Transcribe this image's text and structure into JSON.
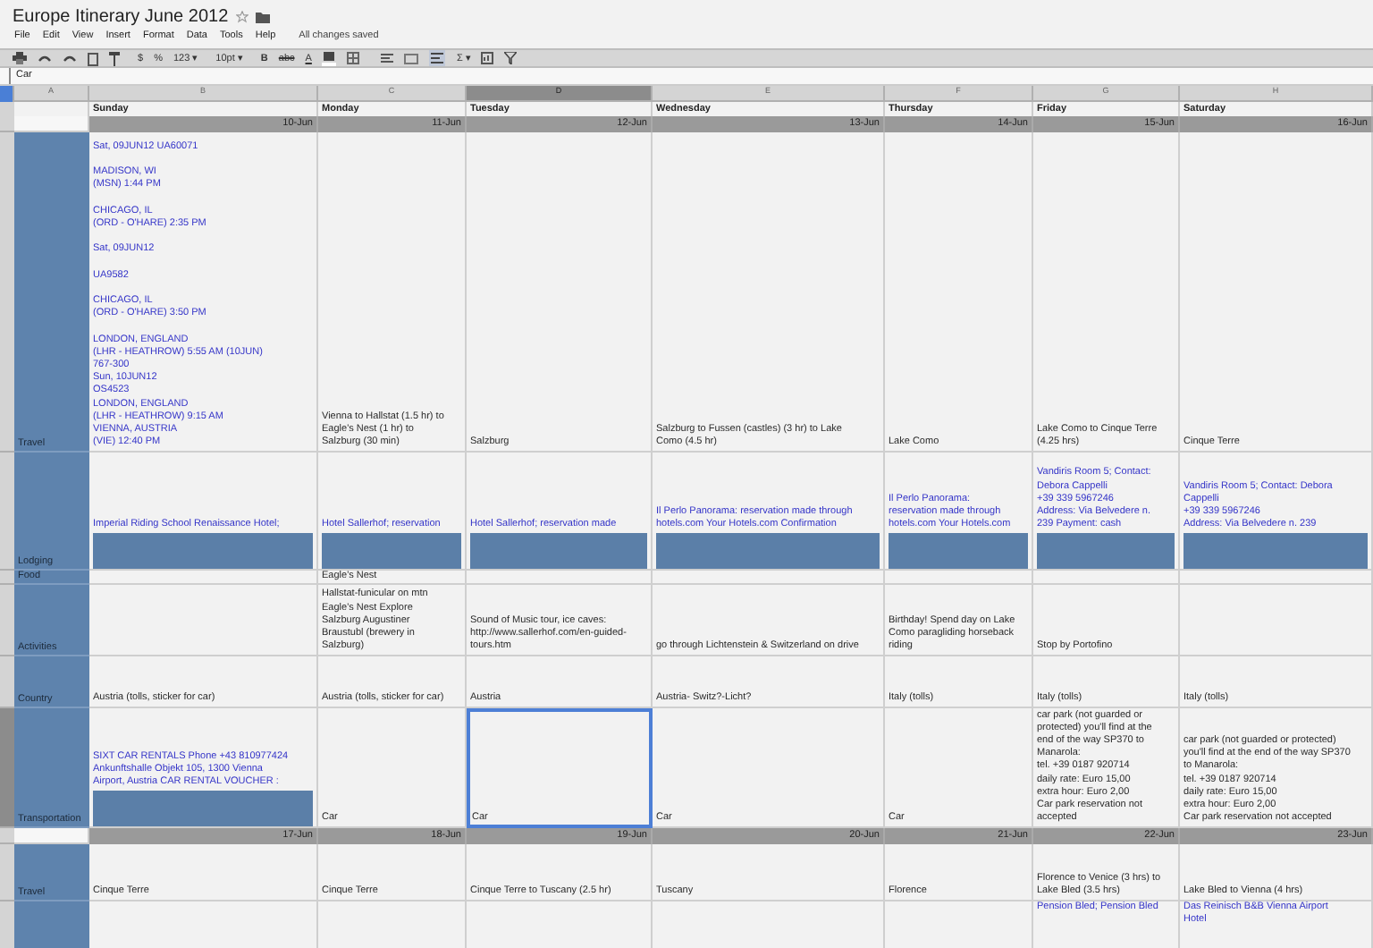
{
  "document": {
    "title": "Europe Itinerary June 2012",
    "save_status": "All changes saved"
  },
  "menu": [
    "File",
    "Edit",
    "View",
    "Insert",
    "Format",
    "Data",
    "Tools",
    "Help"
  ],
  "toolbar": {
    "currency": "$",
    "percent": "%",
    "number_format": "123 ▾",
    "font_size": "10pt ▾",
    "bold": "B",
    "strikethrough": "abc",
    "text_color": "A",
    "sum": "Σ ▾"
  },
  "formula_bar": {
    "value": "Car"
  },
  "columns": [
    {
      "letter": "A",
      "selected": false
    },
    {
      "letter": "B",
      "selected": false
    },
    {
      "letter": "C",
      "selected": false
    },
    {
      "letter": "D",
      "selected": true
    },
    {
      "letter": "E",
      "selected": false
    },
    {
      "letter": "F",
      "selected": false
    },
    {
      "letter": "G",
      "selected": false
    },
    {
      "letter": "H",
      "selected": false
    }
  ],
  "weeks": [
    {
      "day_names": [
        "Sunday",
        "Monday",
        "Tuesday",
        "Wednesday",
        "Thursday",
        "Friday",
        "Saturday"
      ],
      "dates": [
        "10-Jun",
        "11-Jun",
        "12-Jun",
        "13-Jun",
        "14-Jun",
        "15-Jun",
        "16-Jun"
      ],
      "rows": [
        {
          "label": "Travel",
          "cells": [
            {
              "kind": "link",
              "text": "Sat, 09JUN12 UA60071\n\nMADISON, WI\n(MSN) 1:44 PM\n\nCHICAGO, IL\n(ORD - O'HARE) 2:35 PM\n\nSat, 09JUN12\n\nUA9582\n\nCHICAGO, IL\n(ORD - O'HARE) 3:50 PM\n\nLONDON, ENGLAND\n(LHR - HEATHROW) 5:55 AM (10JUN)\n767-300\nSun, 10JUN12\nOS4523\nLONDON, ENGLAND\n(LHR - HEATHROW) 9:15 AM\nVIENNA, AUSTRIA\n(VIE) 12:40 PM",
              "selected": false
            },
            {
              "kind": "plain",
              "text": "Vienna to Hallstat (1.5 hr) to\nEagle's Nest (1 hr) to\nSalzburg (30 min)",
              "selected": false
            },
            {
              "kind": "plain",
              "text": "Salzburg",
              "selected": false
            },
            {
              "kind": "plain",
              "text": "Salzburg to Fussen (castles) (3 hr) to Lake\nComo (4.5 hr)",
              "selected": false
            },
            {
              "kind": "plain",
              "text": "Lake Como",
              "selected": false
            },
            {
              "kind": "plain",
              "text": "Lake Como to Cinque Terre\n(4.25 hrs)",
              "selected": false
            },
            {
              "kind": "plain",
              "text": "Cinque Terre",
              "selected": false
            }
          ]
        },
        {
          "label": "Lodging",
          "cells": [
            {
              "kind": "link",
              "text": "Imperial Riding School Renaissance Hotel;",
              "redacted": true,
              "selected": false
            },
            {
              "kind": "link",
              "text": "Hotel Sallerhof; reservation",
              "redacted": true,
              "selected": false
            },
            {
              "kind": "link",
              "text": "Hotel Sallerhof; reservation made",
              "redacted": true,
              "selected": false
            },
            {
              "kind": "link",
              "text": "Il Perlo Panorama: reservation made through\nhotels.com Your Hotels.com Confirmation",
              "redacted": true,
              "selected": false
            },
            {
              "kind": "link",
              "text": "Il Perlo Panorama:\nreservation made through\nhotels.com Your Hotels.com",
              "redacted": true,
              "selected": false
            },
            {
              "kind": "link",
              "text": "Vandiris Room 5; Contact:\nDebora Cappelli\n+39 339 5967246\nAddress: Via Belvedere n.\n239 Payment: cash",
              "redacted": true,
              "selected": false
            },
            {
              "kind": "link",
              "text": "Vandiris Room 5; Contact: Debora\nCappelli\n+39 339 5967246\nAddress: Via Belvedere n. 239",
              "redacted": true,
              "selected": false
            }
          ]
        },
        {
          "label": "Food",
          "cells": [
            {
              "selected": false
            },
            {
              "kind": "plain",
              "text": "Eagle's Nest",
              "selected": false
            },
            {
              "selected": false
            },
            {
              "selected": false
            },
            {
              "selected": false
            },
            {
              "selected": false
            },
            {
              "selected": false
            }
          ]
        },
        {
          "label": "Activities",
          "cells": [
            {
              "selected": false
            },
            {
              "kind": "plain",
              "text": "Hallstat-funicular on mtn\nEagle's Nest Explore\nSalzburg Augustiner\nBraustubl (brewery in\nSalzburg)",
              "selected": false
            },
            {
              "kind": "plain",
              "text": "Sound of Music tour, ice caves:\nhttp://www.sallerhof.com/en-guided-\ntours.htm",
              "selected": false
            },
            {
              "kind": "plain",
              "text": "go through Lichtenstein & Switzerland on drive",
              "selected": false
            },
            {
              "kind": "plain",
              "text": "Birthday! Spend day on Lake\nComo paragliding horseback\nriding",
              "selected": false
            },
            {
              "kind": "plain",
              "text": "Stop by Portofino",
              "selected": false
            },
            {
              "selected": false
            }
          ]
        },
        {
          "label": "Country",
          "cells": [
            {
              "kind": "plain",
              "text": "Austria (tolls, sticker for car)",
              "selected": false
            },
            {
              "kind": "plain",
              "text": "Austria (tolls, sticker for car)",
              "selected": false
            },
            {
              "kind": "plain",
              "text": "Austria",
              "selected": false
            },
            {
              "kind": "plain",
              "text": "Austria- Switz?-Licht?",
              "selected": false
            },
            {
              "kind": "plain",
              "text": "Italy (tolls)",
              "selected": false
            },
            {
              "kind": "plain",
              "text": "Italy (tolls)",
              "selected": false
            },
            {
              "kind": "plain",
              "text": "Italy (tolls)",
              "selected": false
            }
          ]
        },
        {
          "label": "Transportation",
          "selected": true,
          "cells": [
            {
              "kind": "link",
              "text": "SIXT CAR RENTALS Phone +43 810977424\nAnkunftshalle Objekt 105, 1300 Vienna\nAirport, Austria CAR RENTAL VOUCHER :",
              "redacted": true,
              "selected": false
            },
            {
              "kind": "plain",
              "text": "Car",
              "selected": false
            },
            {
              "kind": "plain",
              "text": "Car",
              "selected": true
            },
            {
              "kind": "plain",
              "text": "Car",
              "selected": false
            },
            {
              "kind": "plain",
              "text": "Car",
              "selected": false
            },
            {
              "kind": "plain",
              "text": "car park (not guarded or\nprotected) you'll find at the\nend of the way SP370 to\nManarola:\ntel. +39 0187 920714\ndaily rate: Euro 15,00\nextra hour: Euro 2,00\nCar park reservation not\naccepted",
              "selected": false
            },
            {
              "kind": "plain",
              "text": "car park (not guarded or protected)\nyou'll find at the end of the way SP370\nto Manarola:\ntel. +39 0187 920714\ndaily rate: Euro 15,00\nextra hour: Euro 2,00\nCar park reservation not accepted",
              "selected": false
            }
          ]
        }
      ]
    },
    {
      "dates": [
        "17-Jun",
        "18-Jun",
        "19-Jun",
        "20-Jun",
        "21-Jun",
        "22-Jun",
        "23-Jun"
      ],
      "rows": [
        {
          "label": "Travel",
          "cells": [
            {
              "kind": "plain",
              "text": "Cinque Terre",
              "selected": false
            },
            {
              "kind": "plain",
              "text": "Cinque Terre",
              "selected": false
            },
            {
              "kind": "plain",
              "text": "Cinque Terre to Tuscany (2.5 hr)",
              "selected": false
            },
            {
              "kind": "plain",
              "text": "Tuscany",
              "selected": false
            },
            {
              "kind": "plain",
              "text": "Florence",
              "selected": false
            },
            {
              "kind": "plain",
              "text": "Florence to Venice (3 hrs) to\nLake Bled (3.5 hrs)",
              "selected": false
            },
            {
              "kind": "plain",
              "text": "Lake Bled to Vienna (4 hrs)",
              "selected": false
            }
          ]
        },
        {
          "cells": [
            {
              "selected": false
            },
            {
              "selected": false
            },
            {
              "selected": false
            },
            {
              "selected": false
            },
            {
              "selected": false
            },
            {
              "kind": "link",
              "text": "Pension Bled; Pension Bled",
              "selected": false
            },
            {
              "kind": "link",
              "text": "Das Reinisch B&B Vienna Airport\nHotel",
              "selected": false
            }
          ]
        }
      ]
    }
  ]
}
